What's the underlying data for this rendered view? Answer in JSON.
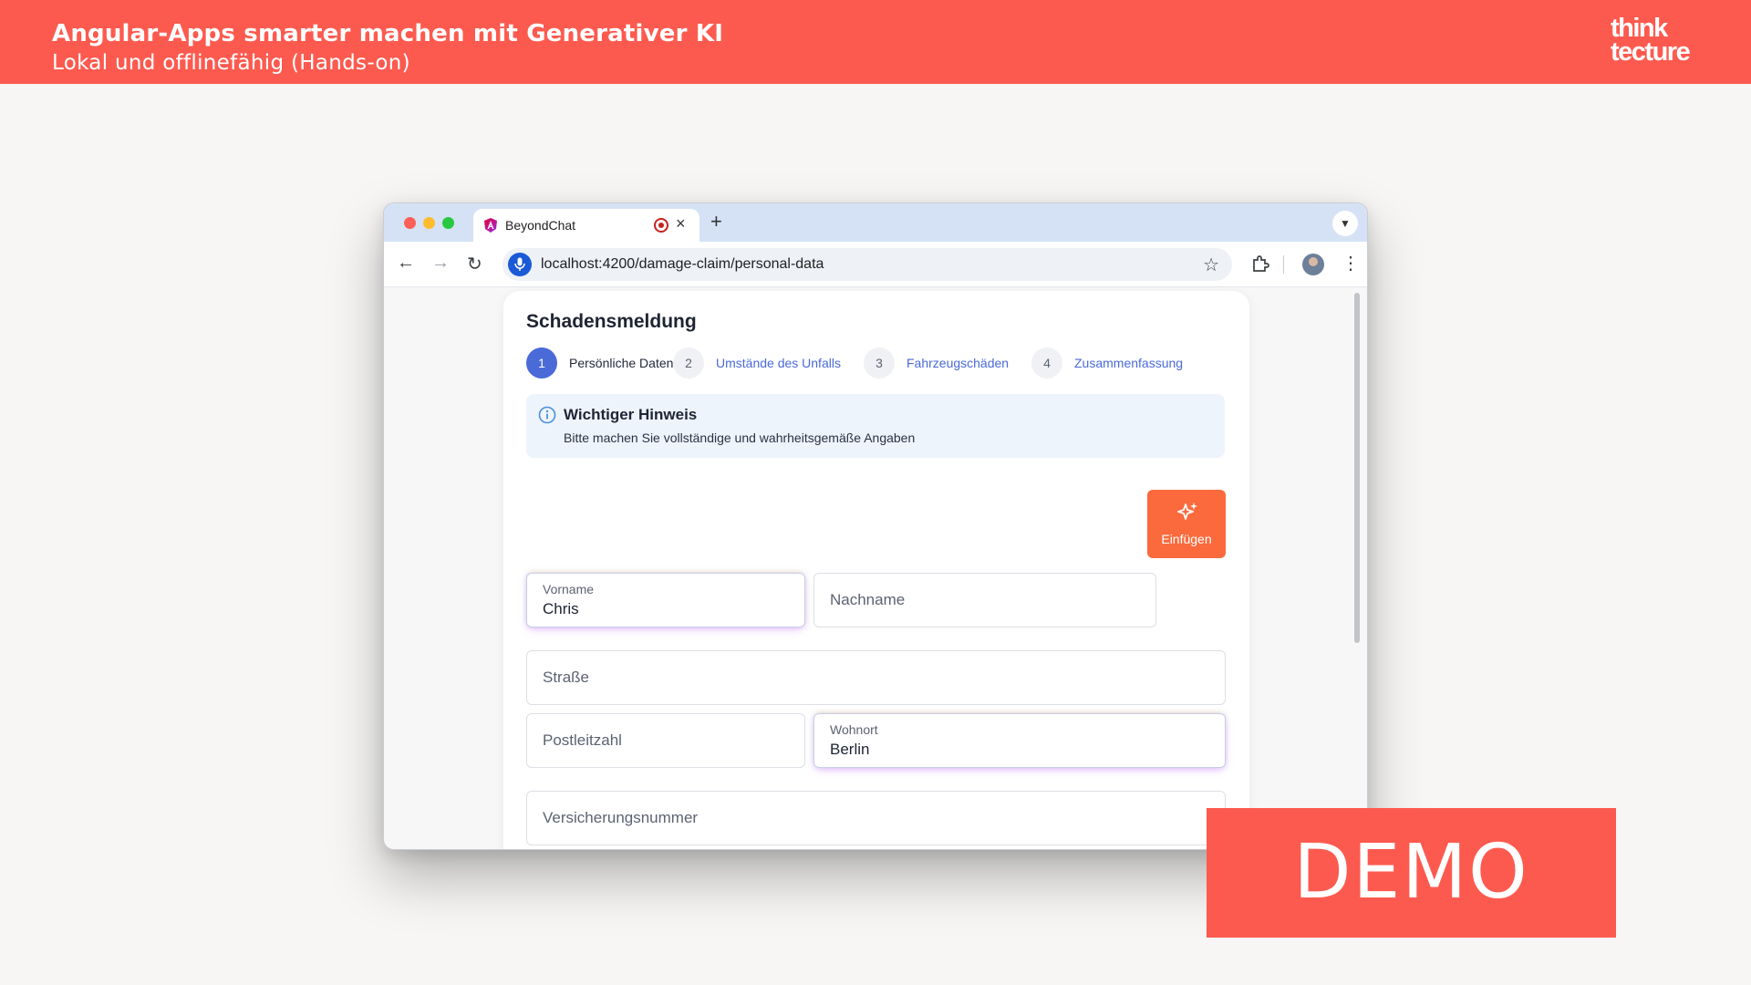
{
  "slide": {
    "title": "Angular-Apps smarter machen mit Generativer KI",
    "subtitle": "Lokal und offlinefähig (Hands-on)",
    "logo_line1": "think",
    "logo_line2": "tecture",
    "demo_label": "DEMO",
    "brand_color": "#fd5a4f"
  },
  "browser": {
    "tab_title": "BeyondChat",
    "tab_close": "×",
    "new_tab": "+",
    "url": "localhost:4200/damage-claim/personal-data",
    "icons": [
      "back-icon",
      "forward-icon",
      "reload-icon",
      "voice-search-icon",
      "bookmark-star-icon",
      "extensions-icon",
      "profile-avatar",
      "more-menu-icon",
      "tab-list-icon"
    ]
  },
  "form": {
    "title": "Schadensmeldung",
    "steps": [
      {
        "number": "1",
        "label": "Persönliche Daten",
        "active": true
      },
      {
        "number": "2",
        "label": "Umstände des Unfalls",
        "active": false
      },
      {
        "number": "3",
        "label": "Fahrzeugschäden",
        "active": false
      },
      {
        "number": "4",
        "label": "Zusammenfassung",
        "active": false
      }
    ],
    "notice": {
      "title": "Wichtiger Hinweis",
      "text": "Bitte machen Sie vollständige und wahrheitsgemäße Angaben"
    },
    "paste_button": "Einfügen",
    "accent_color": "#4a6ad8",
    "button_color": "#fa6a3d",
    "fields": {
      "vorname": {
        "label": "Vorname",
        "value": "Chris"
      },
      "nachname": {
        "placeholder": "Nachname"
      },
      "strasse": {
        "placeholder": "Straße"
      },
      "postleitzahl": {
        "placeholder": "Postleitzahl"
      },
      "wohnort": {
        "label": "Wohnort",
        "value": "Berlin"
      },
      "versicherungsnummer": {
        "placeholder": "Versicherungsnummer"
      }
    }
  }
}
